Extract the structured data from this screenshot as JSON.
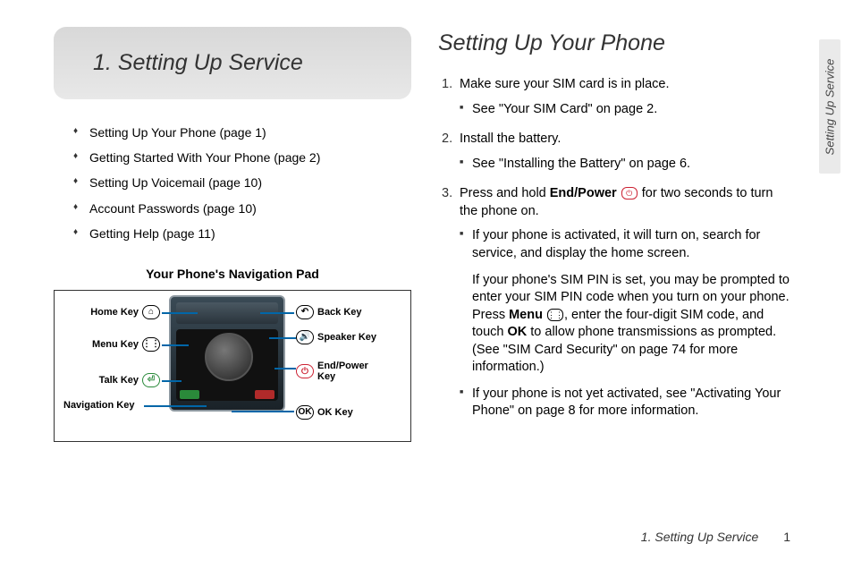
{
  "left": {
    "heading": "1.  Setting Up Service",
    "toc": [
      "Setting Up Your Phone (page 1)",
      "Getting Started With Your Phone (page 2)",
      "Setting Up Voicemail (page 10)",
      "Account Passwords (page 10)",
      "Getting Help (page 11)"
    ],
    "navpad_title": "Your Phone's Navigation Pad",
    "callouts": {
      "home": "Home Key",
      "menu": "Menu Key",
      "talk": "Talk Key",
      "nav": "Navigation Key",
      "back": "Back Key",
      "speaker": "Speaker Key",
      "endpower": "End/Power Key",
      "ok": "OK Key"
    },
    "icons": {
      "home": "⌂",
      "menu": "⋮⋮",
      "talk": "⏎",
      "back": "↶",
      "speaker": "🔊",
      "endpower": "⏻",
      "ok": "OK"
    }
  },
  "right": {
    "title": "Setting Up Your Phone",
    "steps": {
      "s1": "Make sure your SIM card is in place.",
      "s1_sub1": "See \"Your SIM Card\" on page 2.",
      "s2": "Install the battery.",
      "s2_sub1": "See \"Installing the Battery\" on page 6.",
      "s3_a": "Press and hold ",
      "s3_bold": "End/Power",
      "s3_b": " for two seconds to turn the phone on.",
      "s3_sub1": "If your phone is activated, it will turn on, search for service, and display the home screen.",
      "s3_sub2_a": "If your phone's SIM PIN is set, you may be prompted to enter your SIM PIN code when you turn on your phone. Press ",
      "s3_sub2_bold1": "Menu",
      "s3_sub2_b": ", enter the four-digit SIM code, and touch ",
      "s3_sub2_bold2": "OK",
      "s3_sub2_c": " to allow phone transmissions as prompted. (See \"SIM Card Security\" on page 74 for more information.)",
      "s3_sub3": "If your phone is not yet activated, see \"Activating Your Phone\" on page 8 for more information."
    }
  },
  "footer": {
    "text": "1. Setting Up Service",
    "page": "1"
  },
  "sidetab": "Setting Up Service"
}
